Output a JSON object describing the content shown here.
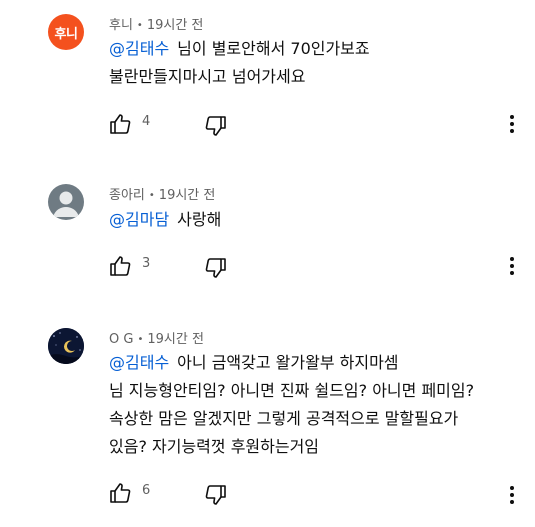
{
  "comments": [
    {
      "avatar": {
        "type": "text",
        "text": "후니",
        "bg": "#f4511e"
      },
      "author": "후니",
      "time": "19시간 전",
      "mention": "@김태수",
      "lines": [
        "님이 별로안해서 70인가보죠",
        "불란만들지마시고 넘어가세요"
      ],
      "likes": "4"
    },
    {
      "avatar": {
        "type": "default-user",
        "bg": "#6f7b83"
      },
      "author": "종아리",
      "time": "19시간 전",
      "mention": "@김마담",
      "lines": [
        "사랑해"
      ],
      "likes": "3"
    },
    {
      "avatar": {
        "type": "night-moon",
        "bg": "#0c1633"
      },
      "author": "O G",
      "time": "19시간 전",
      "mention": "@김태수",
      "lines": [
        "아니 금액갖고 왈가왈부 하지마셈",
        "님 지능형안티임? 아니면 진짜 쉴드임? 아니면 페미임?",
        "속상한 맘은 알겠지만 그렇게 공격적으로 말할필요가",
        "있음? 자기능력껏 후원하는거임"
      ],
      "likes": "6"
    }
  ],
  "colors": {
    "mention": "#065fd4",
    "meta": "#606060",
    "text": "#0f0f0f"
  },
  "icons": {
    "like": "thumb-up-icon",
    "dislike": "thumb-down-icon",
    "more": "more-vertical-icon"
  }
}
